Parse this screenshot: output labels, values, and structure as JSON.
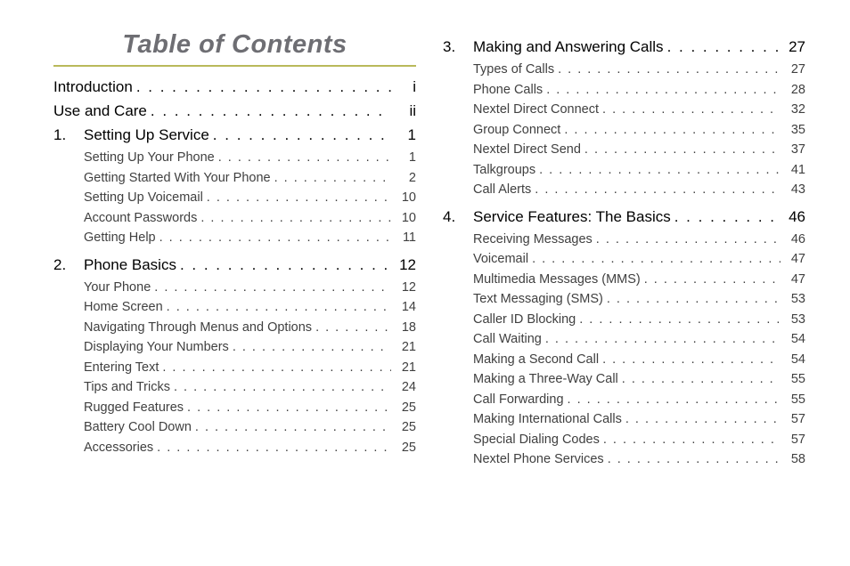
{
  "title": "Table of Contents",
  "left": {
    "top": [
      {
        "label": "Introduction",
        "page": "i"
      },
      {
        "label": "Use and Care",
        "page": "ii"
      }
    ],
    "ch1": {
      "num": "1.",
      "label": "Setting Up Service",
      "page": "1",
      "subs": [
        {
          "label": "Setting Up Your Phone",
          "page": "1"
        },
        {
          "label": "Getting Started With Your Phone",
          "page": "2"
        },
        {
          "label": "Setting Up Voicemail",
          "page": "10"
        },
        {
          "label": "Account Passwords",
          "page": "10"
        },
        {
          "label": "Getting Help",
          "page": "11"
        }
      ]
    },
    "ch2": {
      "num": "2.",
      "label": "Phone Basics",
      "page": "12",
      "subs": [
        {
          "label": "Your Phone",
          "page": "12"
        },
        {
          "label": "Home Screen",
          "page": "14"
        },
        {
          "label": "Navigating Through Menus and Options",
          "page": "18"
        },
        {
          "label": "Displaying Your Numbers",
          "page": "21"
        },
        {
          "label": "Entering Text",
          "page": "21"
        },
        {
          "label": "Tips and Tricks",
          "page": "24"
        },
        {
          "label": "Rugged Features",
          "page": "25"
        },
        {
          "label": "Battery Cool Down",
          "page": "25"
        },
        {
          "label": "Accessories",
          "page": "25"
        }
      ]
    }
  },
  "right": {
    "ch3": {
      "num": "3.",
      "label": "Making and Answering Calls",
      "page": "27",
      "subs": [
        {
          "label": "Types of Calls",
          "page": "27"
        },
        {
          "label": "Phone Calls",
          "page": "28"
        },
        {
          "label": "Nextel Direct Connect",
          "page": "32"
        },
        {
          "label": "Group Connect",
          "page": "35"
        },
        {
          "label": "Nextel Direct Send",
          "page": "37"
        },
        {
          "label": "Talkgroups",
          "page": "41"
        },
        {
          "label": "Call Alerts",
          "page": "43"
        }
      ]
    },
    "ch4": {
      "num": "4.",
      "label": "Service Features: The Basics",
      "page": "46",
      "subs": [
        {
          "label": "Receiving Messages",
          "page": "46"
        },
        {
          "label": "Voicemail",
          "page": "47"
        },
        {
          "label": "Multimedia Messages (MMS)",
          "page": "47"
        },
        {
          "label": "Text Messaging (SMS)",
          "page": "53"
        },
        {
          "label": "Caller ID Blocking",
          "page": "53"
        },
        {
          "label": "Call Waiting",
          "page": "54"
        },
        {
          "label": "Making a Second Call",
          "page": "54"
        },
        {
          "label": "Making a Three-Way Call",
          "page": "55"
        },
        {
          "label": "Call Forwarding",
          "page": "55"
        },
        {
          "label": "Making International Calls",
          "page": "57"
        },
        {
          "label": "Special Dialing Codes",
          "page": "57"
        },
        {
          "label": "Nextel Phone Services",
          "page": "58"
        }
      ]
    }
  }
}
